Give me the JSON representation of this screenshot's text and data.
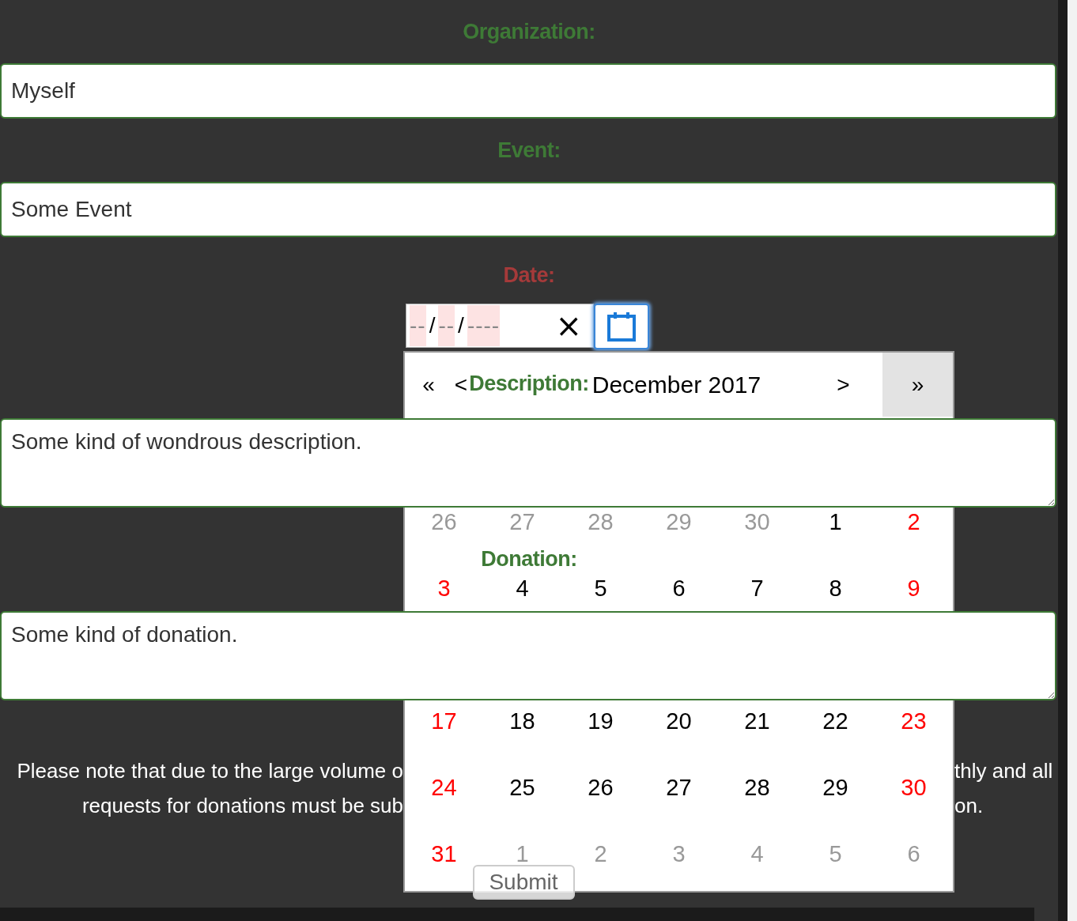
{
  "form": {
    "organization": {
      "label": "Organization:",
      "value": "Myself"
    },
    "event": {
      "label": "Event:",
      "value": "Some Event"
    },
    "date": {
      "label": "Date:",
      "invalid": true,
      "segments": [
        {
          "text": "--",
          "kind": "placeholder"
        },
        {
          "text": "/",
          "kind": "separator"
        },
        {
          "text": "--",
          "kind": "placeholder"
        },
        {
          "text": "/",
          "kind": "separator"
        },
        {
          "text": "----",
          "kind": "placeholder"
        }
      ],
      "clear": "×",
      "picker_open": true
    },
    "description": {
      "label": "Description:",
      "value": "Some kind of wondrous description."
    },
    "donation": {
      "label": "Donation:",
      "value": "Some kind of donation."
    },
    "note_lines": [
      {
        "left": "Please note that due to the large volume o",
        "right": "thly and all"
      },
      {
        "left": "requests for donations must be sub",
        "right": "on."
      }
    ],
    "submit": "Submit"
  },
  "calendar": {
    "prev_year": "«",
    "prev_month": "<",
    "title": "December 2017",
    "next_month": ">",
    "next_year": "»",
    "upper_weeks": [
      [
        {
          "text": "26",
          "kind": "other"
        },
        {
          "text": "27",
          "kind": "other"
        },
        {
          "text": "28",
          "kind": "other"
        },
        {
          "text": "29",
          "kind": "other"
        },
        {
          "text": "30",
          "kind": "other"
        },
        {
          "text": "1",
          "kind": "weekday"
        },
        {
          "text": "2",
          "kind": "weekend"
        }
      ],
      [
        {
          "text": "3",
          "kind": "weekend"
        },
        {
          "text": "4",
          "kind": "weekday"
        },
        {
          "text": "5",
          "kind": "weekday"
        },
        {
          "text": "6",
          "kind": "weekday"
        },
        {
          "text": "7",
          "kind": "weekday"
        },
        {
          "text": "8",
          "kind": "weekday"
        },
        {
          "text": "9",
          "kind": "weekend"
        }
      ]
    ],
    "lower_weeks": [
      [
        {
          "text": "17",
          "kind": "weekend"
        },
        {
          "text": "18",
          "kind": "weekday"
        },
        {
          "text": "19",
          "kind": "weekday"
        },
        {
          "text": "20",
          "kind": "weekday"
        },
        {
          "text": "21",
          "kind": "weekday"
        },
        {
          "text": "22",
          "kind": "weekday"
        },
        {
          "text": "23",
          "kind": "weekend"
        }
      ],
      [
        {
          "text": "24",
          "kind": "weekend"
        },
        {
          "text": "25",
          "kind": "weekday"
        },
        {
          "text": "26",
          "kind": "weekday"
        },
        {
          "text": "27",
          "kind": "weekday"
        },
        {
          "text": "28",
          "kind": "weekday"
        },
        {
          "text": "29",
          "kind": "weekday"
        },
        {
          "text": "30",
          "kind": "weekend"
        }
      ],
      [
        {
          "text": "31",
          "kind": "weekend"
        },
        {
          "text": "1",
          "kind": "other"
        },
        {
          "text": "2",
          "kind": "other"
        },
        {
          "text": "3",
          "kind": "other"
        },
        {
          "text": "4",
          "kind": "other"
        },
        {
          "text": "5",
          "kind": "other"
        },
        {
          "text": "6",
          "kind": "other"
        }
      ]
    ]
  }
}
